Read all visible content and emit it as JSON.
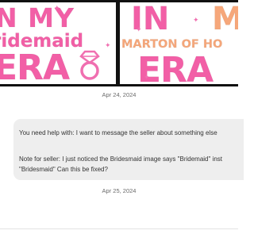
{
  "images": {
    "left": {
      "line1": "N MY",
      "line2": "ridemaid",
      "line3": "ERA",
      "colors": {
        "pink": "#f25fa6",
        "peach": "#f6a77a",
        "sparkle": "#f06fb0"
      }
    },
    "right": {
      "line1": "IN",
      "line1b": "M",
      "line2": "MARTON OF HO",
      "line3": "ERA",
      "colors": {
        "pink": "#f25fa6",
        "peach": "#f6a77a",
        "sparkle": "#f06fb0"
      }
    }
  },
  "conversation": {
    "date1": "Apr 24, 2024",
    "message": {
      "line1": "You need help with: I want to message the seller about something else",
      "line2": "Note for seller: I just noticed the Bridesmaid image says \"Bridemaid\" inst",
      "line3": "\"Bridesmaid\" Can this be fixed?"
    },
    "date2": "Apr 25, 2024"
  }
}
